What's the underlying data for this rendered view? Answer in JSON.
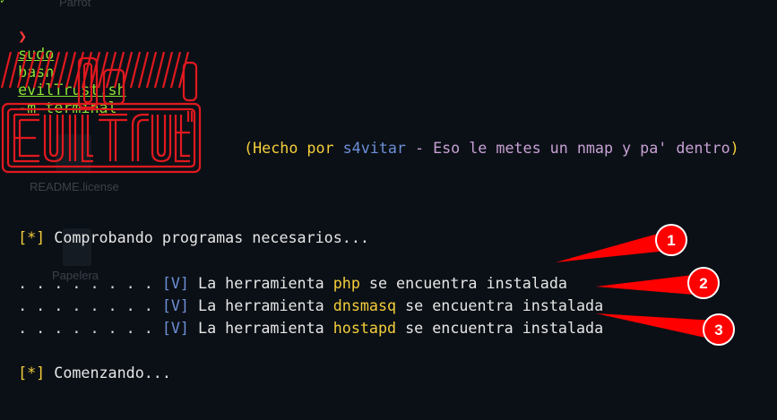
{
  "background": {
    "ghost_labels": [
      "Parrot",
      "README.license",
      "Papelera"
    ]
  },
  "prompt": {
    "arrow": "❯",
    "sudo": "sudo",
    "bash": "bash",
    "script": "evilTrust.sh",
    "args": "-m terminal"
  },
  "banner": {
    "credit_open": "(Hecho por ",
    "author": "s4vitar",
    "credit_rest": " - Eso le metes un nmap y pa' dentro",
    "credit_close": ")"
  },
  "output": {
    "checking_marker": "[*]",
    "checking_text": " Comprobando programas necesarios...",
    "tools": [
      {
        "dots": ". . . . . . . . ",
        "mark": "[V]",
        "prefix": " La herramienta ",
        "name": "php",
        "suffix": " se encuentra instalada"
      },
      {
        "dots": ". . . . . . . . ",
        "mark": "[V]",
        "prefix": " La herramienta ",
        "name": "dnsmasq",
        "suffix": " se encuentra instalada"
      },
      {
        "dots": ". . . . . . . . ",
        "mark": "[V]",
        "prefix": " La herramienta ",
        "name": "hostapd",
        "suffix": " se encuentra instalada"
      }
    ],
    "starting_marker": "[*]",
    "starting_text": " Comenzando..."
  },
  "annotations": {
    "color": "#ff0000",
    "callouts": [
      "1",
      "2",
      "3"
    ]
  }
}
